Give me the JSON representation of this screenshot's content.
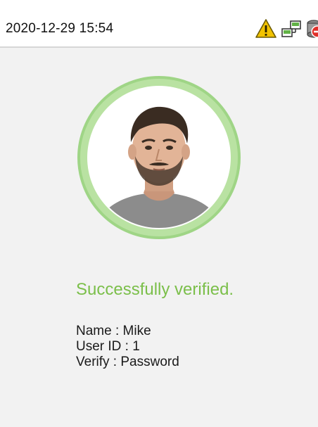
{
  "status_bar": {
    "datetime": "2020-12-29 15:54",
    "icons": [
      "warning-icon",
      "network-icon",
      "server-disconnected-icon"
    ]
  },
  "verification": {
    "result_text": "Successfully verified.",
    "name_line": "Name : Mike",
    "user_id_line": "User ID : 1",
    "verify_line": "Verify : Password"
  },
  "colors": {
    "success": "#7bbf4a",
    "ring": "#b9e2a2",
    "warning": "#f2c300",
    "background": "#f2f2f2"
  }
}
